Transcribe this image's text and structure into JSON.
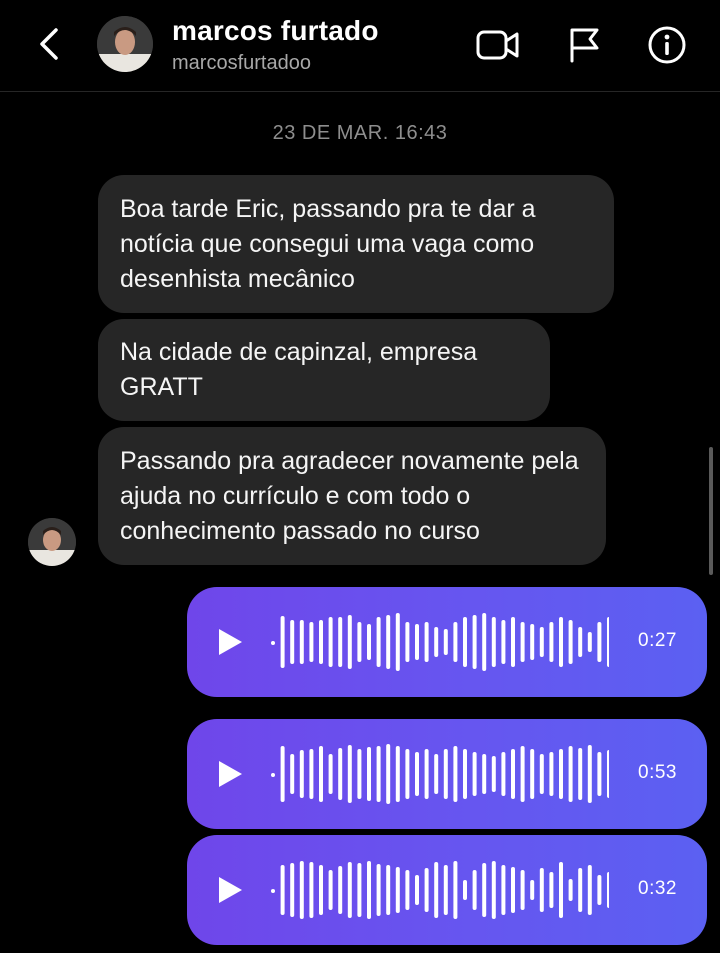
{
  "header": {
    "name": "marcos furtado",
    "username": "marcosfurtadoo",
    "icons": [
      "back-chevron-icon",
      "video-call-icon",
      "flag-icon",
      "info-icon"
    ]
  },
  "conversation": {
    "timestamp": "23 DE MAR. 16:43",
    "messages": [
      "Boa tarde Eric, passando pra te dar a notícia que consegui uma vaga como desenhista mecânico",
      "Na cidade de capinzal, empresa GRATT",
      "Passando pra agradecer novamente pela ajuda no currículo e com todo o conhecimento passado no curso"
    ],
    "voice_messages": [
      {
        "duration": "0:27"
      },
      {
        "duration": "0:53"
      },
      {
        "duration": "0:32"
      }
    ]
  },
  "colors": {
    "background": "#000000",
    "bubble": "#262626",
    "voice_gradient_start": "#6f46ea",
    "voice_gradient_end": "#5b60f2",
    "secondary_text": "#a8a8a8"
  }
}
